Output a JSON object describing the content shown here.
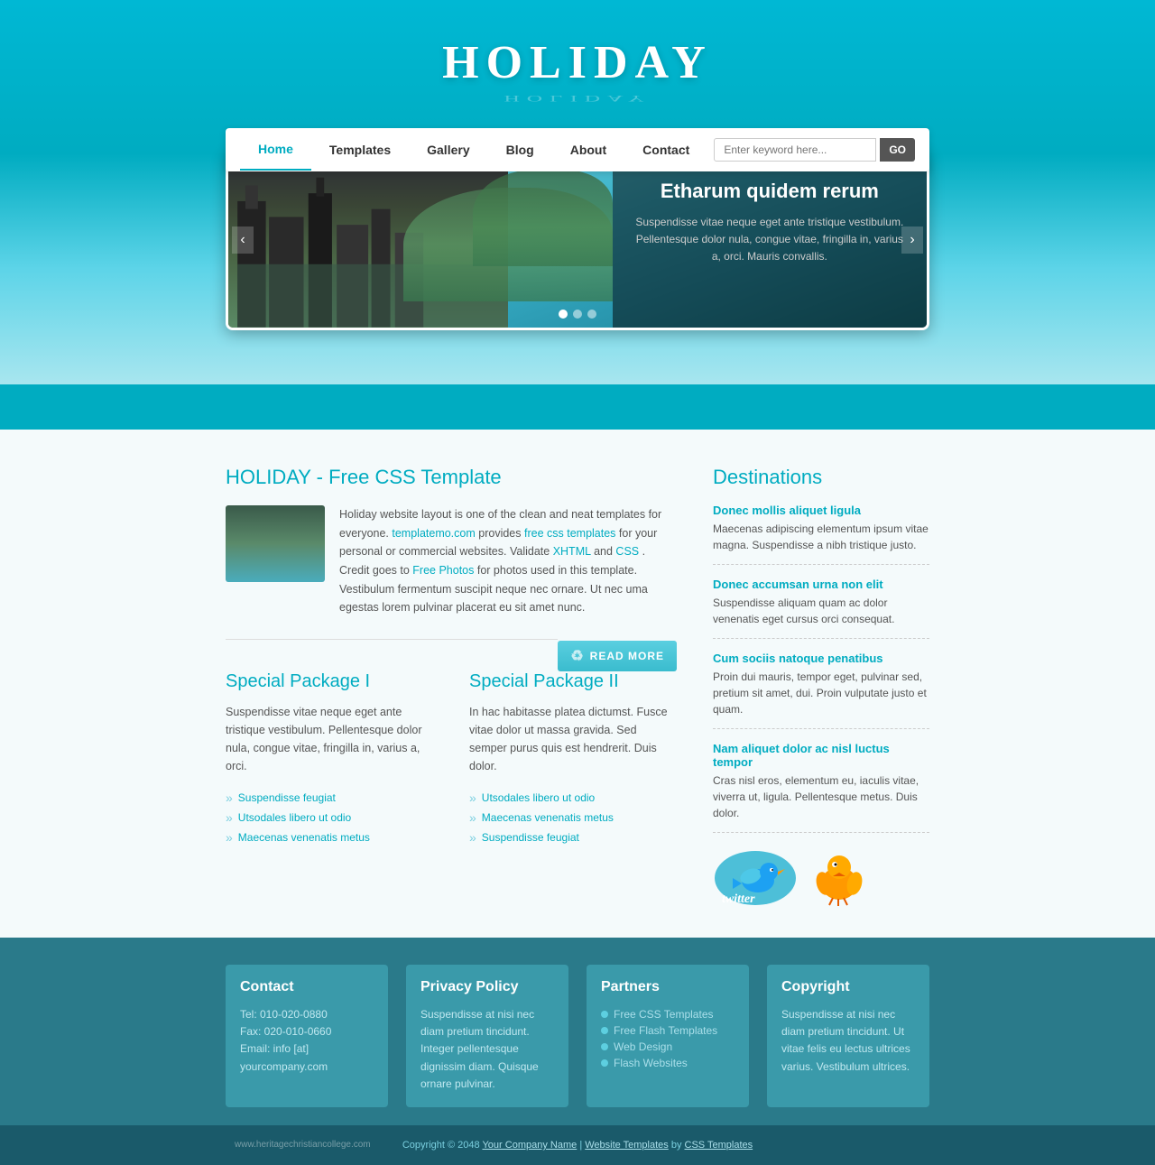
{
  "site": {
    "title": "HOLIDAY",
    "watermark": "www.heritagechristiancollege.com"
  },
  "nav": {
    "links": [
      {
        "label": "Home",
        "active": true
      },
      {
        "label": "Templates",
        "active": false
      },
      {
        "label": "Gallery",
        "active": false
      },
      {
        "label": "Blog",
        "active": false
      },
      {
        "label": "About",
        "active": false
      },
      {
        "label": "Contact",
        "active": false
      }
    ],
    "search_placeholder": "Enter keyword here...",
    "search_btn": "GO"
  },
  "hero": {
    "heading": "Etharum quidem rerum",
    "description": "Suspendisse vitae neque eget ante tristique vestibulum. Pellentesque dolor nula, congue vitae, fringilla in, varius a, orci. Mauris convallis."
  },
  "main": {
    "article_title": "HOLIDAY - Free CSS Template",
    "article_text1": "Holiday website layout is one of the clean and neat templates for everyone.",
    "article_link1": "templatemo.com",
    "article_text2": "provides",
    "article_link2": "free css templates",
    "article_text3": "for your personal or commercial websites. Validate",
    "article_link3": "XHTML",
    "article_text4": "and",
    "article_link4": "CSS",
    "article_text5": ". Credit goes to",
    "article_link5": "Free Photos",
    "article_text6": "for photos used in this template. Vestibulum fermentum suscipit neque nec ornare. Ut nec uma egestas lorem pulvinar placerat eu sit amet nunc.",
    "read_more": "READ MORE"
  },
  "packages": [
    {
      "title": "Special Package I",
      "text": "Suspendisse vitae neque eget ante tristique vestibulum. Pellentesque dolor nula, congue vitae, fringilla in, varius a, orci.",
      "items": [
        "Suspendisse feugiat",
        "Utsodales libero ut odio",
        "Maecenas venenatis metus"
      ]
    },
    {
      "title": "Special Package II",
      "text": "In hac habitasse platea dictumst. Fusce vitae dolor ut massa gravida. Sed semper purus quis est hendrerit. Duis dolor.",
      "items": [
        "Utsodales libero ut odio",
        "Maecenas venenatis metus",
        "Suspendisse feugiat"
      ]
    }
  ],
  "destinations": {
    "title": "Destinations",
    "items": [
      {
        "link": "Donec mollis aliquet ligula",
        "desc": "Maecenas adipiscing elementum ipsum vitae magna. Suspendisse a nibh tristique justo."
      },
      {
        "link": "Donec accumsan urna non elit",
        "desc": "Suspendisse aliquam quam ac dolor venenatis eget cursus orci consequat."
      },
      {
        "link": "Cum sociis natoque penatibus",
        "desc": "Proin dui mauris, tempor eget, pulvinar sed, pretium sit amet, dui. Proin vulputate justo et quam."
      },
      {
        "link": "Nam aliquet dolor ac nisl luctus tempor",
        "desc": "Cras nisl eros, elementum eu, iaculis vitae, viverra ut, ligula. Pellentesque metus. Duis dolor."
      }
    ]
  },
  "footer": {
    "columns": [
      {
        "title": "Contact",
        "lines": [
          "Tel: 010-020-0880",
          "Fax: 020-010-0660",
          "Email: info [at] yourcompany.com"
        ]
      },
      {
        "title": "Privacy Policy",
        "text": "Suspendisse at nisi nec diam pretium tincidunt. Integer pellentesque dignissim diam. Quisque ornare pulvinar."
      },
      {
        "title": "Partners",
        "links": [
          "Free CSS Templates",
          "Free Flash Templates",
          "Web Design",
          "Flash Websites"
        ]
      },
      {
        "title": "Copyright",
        "text": "Suspendisse at nisi nec diam pretium tincidunt. Ut vitae felis eu lectus ultrices varius. Vestibulum ultrices."
      }
    ],
    "copyright": "Copyright © 2048",
    "company_link": "Your Company Name",
    "separator": "|",
    "templates_link": "Website Templates",
    "by": "by",
    "css_link": "CSS Templates"
  }
}
